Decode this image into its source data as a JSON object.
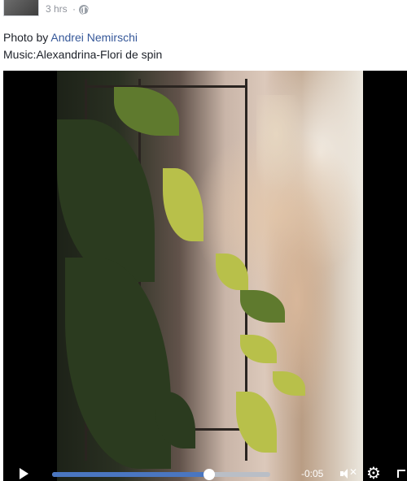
{
  "post": {
    "timestamp": "3 hrs",
    "separator": "·",
    "privacy_icon": "globe-icon",
    "caption": {
      "prefix": "Photo by ",
      "author": "Andrei Nemirschi",
      "music_line": "Music:Alexandrina-Flori de spin"
    }
  },
  "video": {
    "controls": {
      "play_icon": "play-icon",
      "progress": 0.72,
      "time_remaining": "-0:05",
      "mute_icon": "mute-icon",
      "settings_icon": "gear-icon",
      "fullscreen_icon": "fullscreen-icon"
    }
  },
  "colors": {
    "link": "#365899",
    "meta": "#90949c",
    "progress_fill": "#4a76c0"
  }
}
